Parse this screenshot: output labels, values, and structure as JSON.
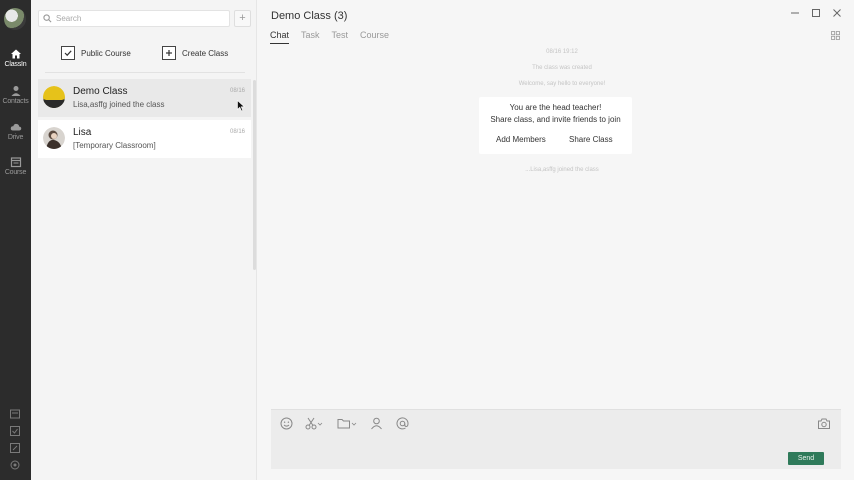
{
  "rail": {
    "items": [
      {
        "label": "ClassIn",
        "icon": "home-icon"
      },
      {
        "label": "Contacts",
        "icon": "person-icon"
      },
      {
        "label": "Drive",
        "icon": "cloud-icon"
      },
      {
        "label": "Course",
        "icon": "calendar-icon"
      }
    ]
  },
  "sidebar": {
    "search_placeholder": "Search",
    "add_label": "+",
    "public_course": "Public Course",
    "create_class": "Create Class",
    "conversations": [
      {
        "name": "Demo Class",
        "preview": "Lisa,asffg joined the class",
        "date": "08/16"
      },
      {
        "name": "Lisa",
        "preview": "[Temporary Classroom]",
        "date": "08/16"
      }
    ]
  },
  "chat": {
    "title": "Demo Class (3)",
    "tabs": [
      "Chat",
      "Task",
      "Test",
      "Course"
    ],
    "system": [
      "08/16 19:12",
      "The class was created",
      "Welcome, say hello to everyone!"
    ],
    "card": {
      "line1": "You are the head teacher!",
      "line2": "Share class, and invite friends to join",
      "add_members": "Add Members",
      "share_class": "Share Class"
    },
    "joined_notice": "...Lisa,asffg joined the class",
    "send": "Send"
  },
  "colors": {
    "rail": "#2c2c2c",
    "send": "#2f7a5a",
    "accent_yellow": "#e6c21a"
  }
}
